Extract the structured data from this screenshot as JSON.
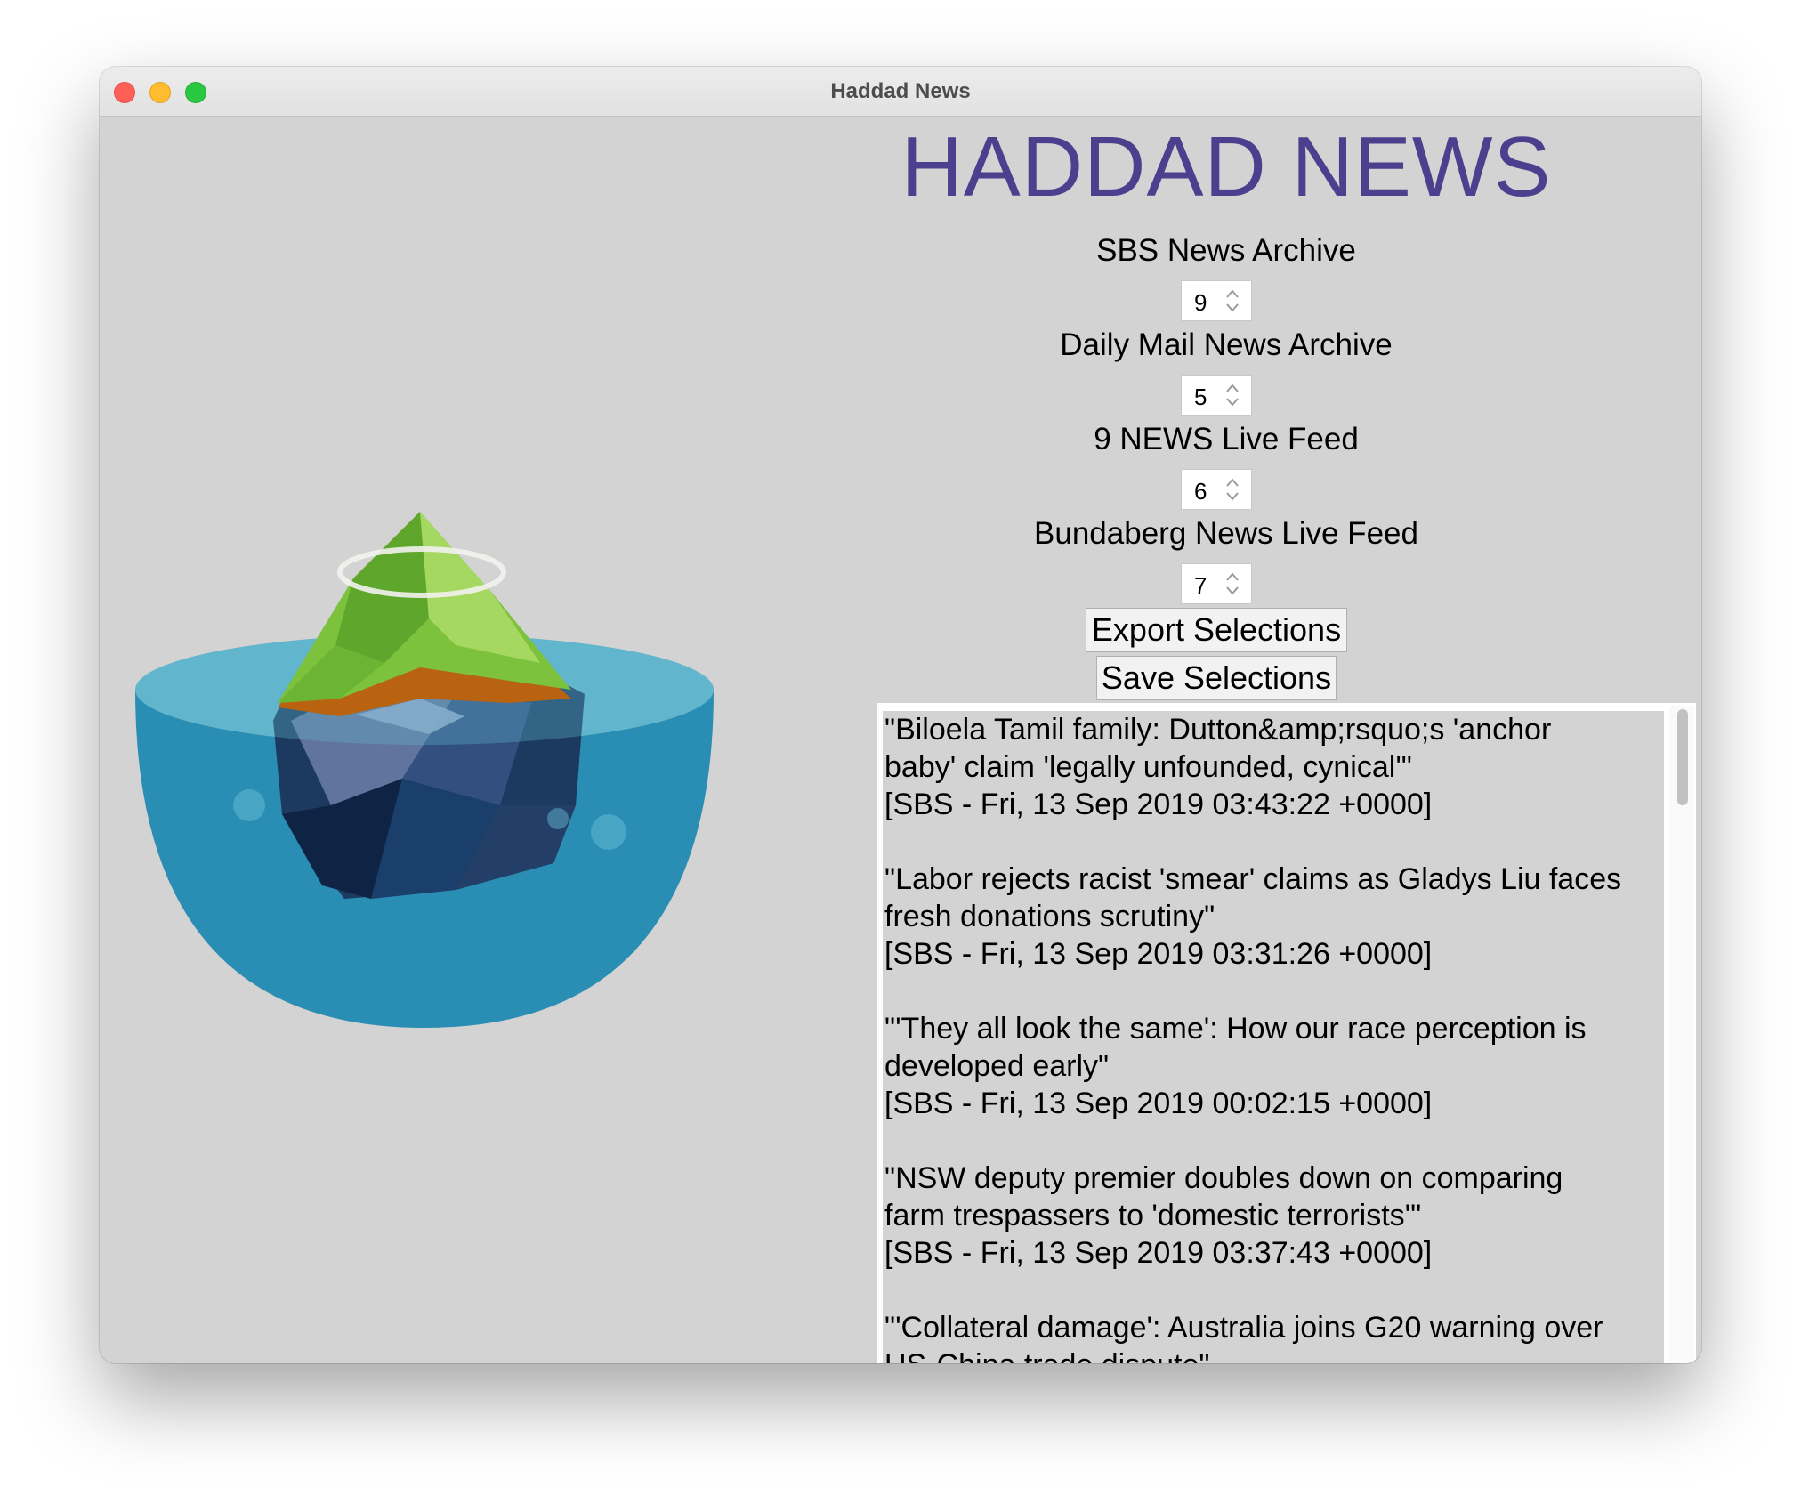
{
  "window": {
    "title": "Haddad News"
  },
  "app": {
    "title": "HADDAD NEWS"
  },
  "feeds": [
    {
      "label": "SBS News Archive",
      "count": "9"
    },
    {
      "label": "Daily Mail News Archive",
      "count": "5"
    },
    {
      "label": "9 NEWS Live Feed",
      "count": "6"
    },
    {
      "label": "Bundaberg News Live Feed",
      "count": "7"
    }
  ],
  "buttons": {
    "export": "Export Selections",
    "save": "Save Selections"
  },
  "news": [
    {
      "line1": "\"Biloela Tamil family: Dutton&amp;rsquo;s 'anchor",
      "line2": "baby' claim 'legally unfounded, cynical'\"",
      "meta": "[SBS - Fri, 13 Sep 2019 03:43:22 +0000]"
    },
    {
      "line1": "\"Labor rejects racist 'smear' claims as Gladys Liu faces",
      "line2": "fresh donations scrutiny\"",
      "meta": "[SBS - Fri, 13 Sep 2019 03:31:26 +0000]"
    },
    {
      "line1": "\"'They all look the same': How our race perception is",
      "line2": "developed early\"",
      "meta": "[SBS - Fri, 13 Sep 2019 00:02:15 +0000]"
    },
    {
      "line1": "\"NSW deputy premier doubles down on comparing",
      "line2": "farm trespassers to 'domestic terrorists'\"",
      "meta": "[SBS - Fri, 13 Sep 2019 03:37:43 +0000]"
    },
    {
      "line1": "\"'Collateral damage': Australia joins G20 warning over",
      "line2": "US-China trade dispute\"",
      "meta": ""
    }
  ],
  "colors": {
    "title": "#4b3f8e",
    "background": "#d3d3d3",
    "close": "#fe5f57",
    "minimize": "#febc2e",
    "maximize": "#28c840"
  },
  "icons": [
    "close-icon",
    "minimize-icon",
    "maximize-icon",
    "spinner-arrows-icon",
    "floating-island-illustration"
  ]
}
